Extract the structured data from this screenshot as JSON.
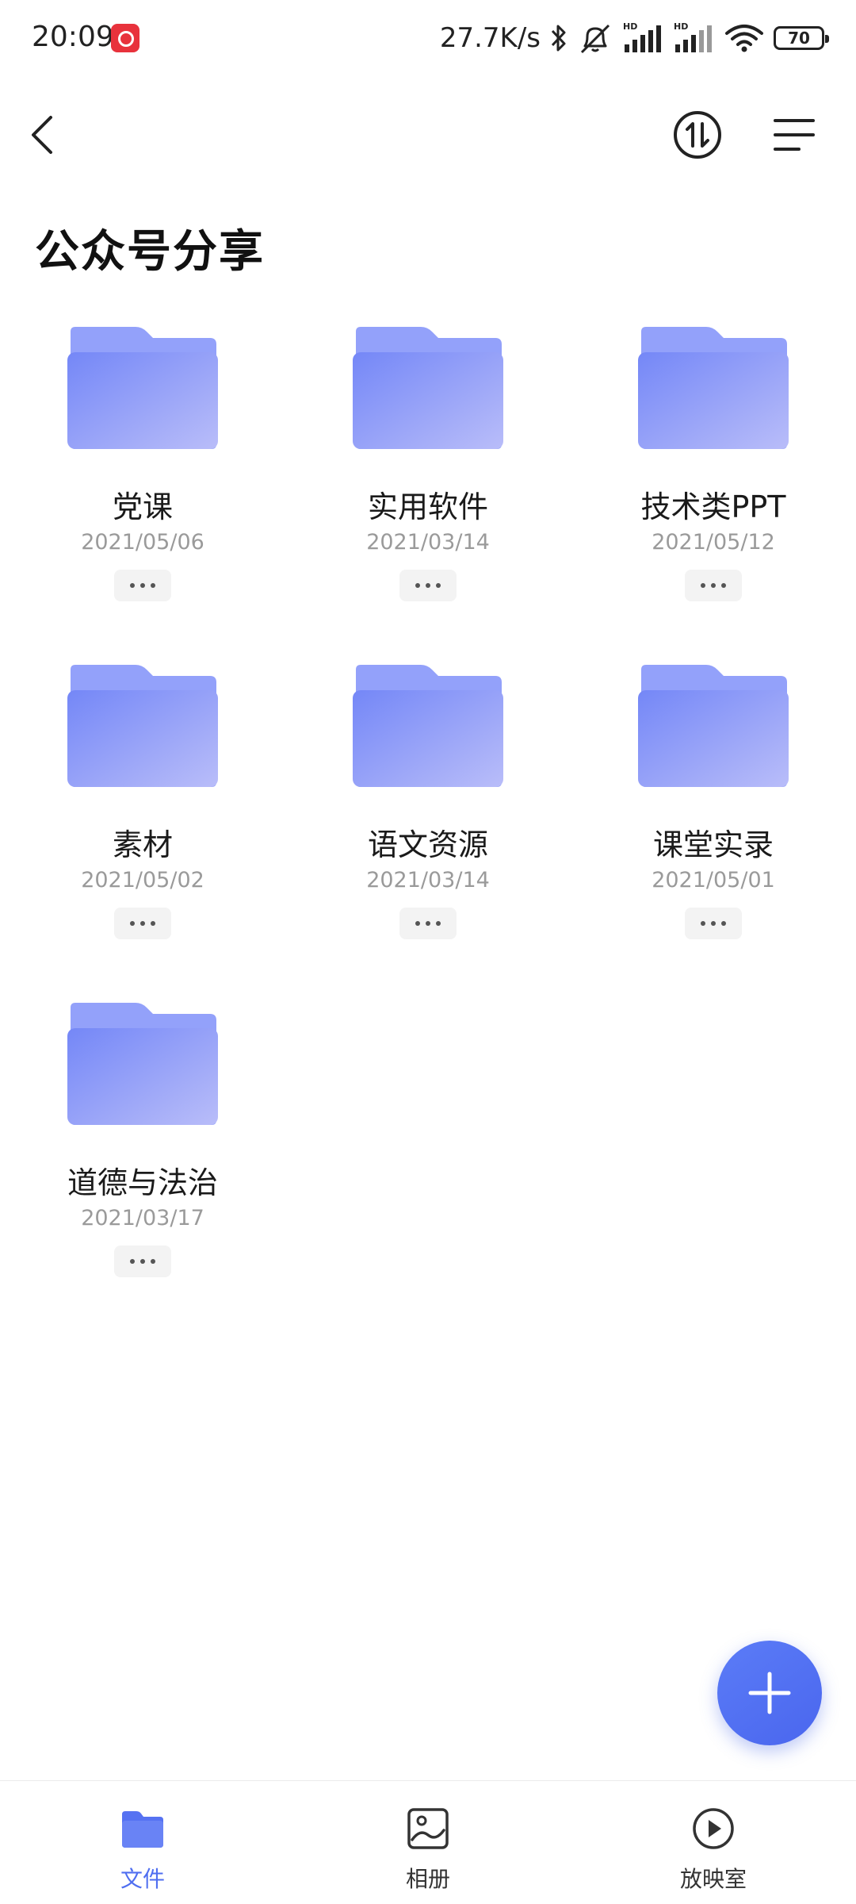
{
  "status_bar": {
    "time": "20:09",
    "network_speed": "27.7K/s",
    "battery": "70",
    "hd_label": "HD"
  },
  "toolbar": {
    "back_icon": "chevron-left-icon",
    "transfer_icon": "transfer-arrows-icon",
    "menu_icon": "menu-lines-icon"
  },
  "page": {
    "title": "公众号分享"
  },
  "folders": [
    {
      "name": "党课",
      "date": "2021/05/06"
    },
    {
      "name": "实用软件",
      "date": "2021/03/14"
    },
    {
      "name": "技术类PPT",
      "date": "2021/05/12"
    },
    {
      "name": "素材",
      "date": "2021/05/02"
    },
    {
      "name": "语文资源",
      "date": "2021/03/14"
    },
    {
      "name": "课堂实录",
      "date": "2021/05/01"
    },
    {
      "name": "道德与法治",
      "date": "2021/03/17"
    }
  ],
  "fab": {
    "icon": "plus-icon"
  },
  "bottom_nav": [
    {
      "label": "文件",
      "icon": "folder-icon",
      "active": true
    },
    {
      "label": "相册",
      "icon": "photo-album-icon",
      "active": false
    },
    {
      "label": "放映室",
      "icon": "play-circle-icon",
      "active": false
    }
  ],
  "colors": {
    "accent": "#4f6ef0",
    "folder_light": "#a9b6fb",
    "folder_dark": "#6f83f6"
  }
}
